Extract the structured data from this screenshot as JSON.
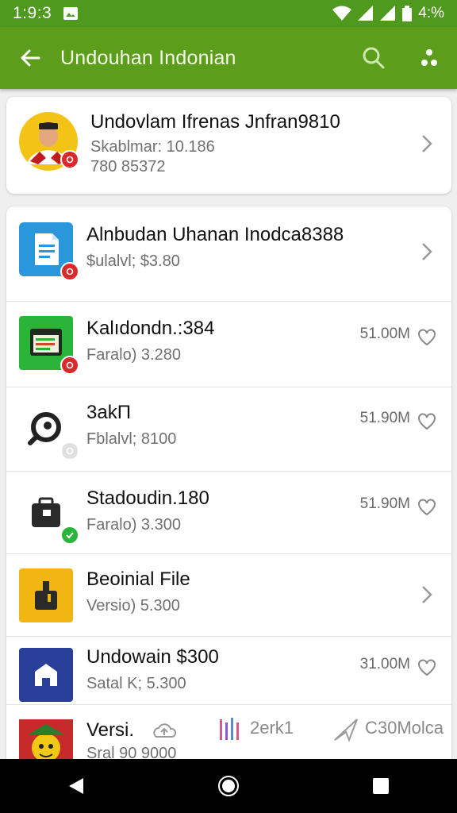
{
  "status_bar": {
    "time": "1:9:3",
    "battery": "4:%"
  },
  "app_bar": {
    "title": "Undouhan Indonian"
  },
  "profile": {
    "title": "Undovlam Ifrenas Jnfran9810",
    "subtitle": "Skablmar: 10.186",
    "detail": "780 85372"
  },
  "items": [
    {
      "title": "Alnbudan Uhanan Inodca8388",
      "sub": "$ulalvl; $3.80",
      "size": "",
      "trail": "chevron",
      "color": "#2a97dc"
    },
    {
      "title": "Kalıdondn.:384",
      "sub": "Faralo) 3.280",
      "size": "51.00M",
      "trail": "heart",
      "color": "#2bb43a"
    },
    {
      "title": "3akΠ",
      "sub": "Fblalvl; 8100",
      "size": "51.90M",
      "trail": "heart",
      "color": "#ffffff"
    },
    {
      "title": "Stadoudin.180",
      "sub": "Faralo) 3.300",
      "size": "51.90M",
      "trail": "heart",
      "color": "#ffffff"
    },
    {
      "title": "Beoinial File",
      "sub": "Versio) 5.300",
      "size": "",
      "trail": "chevron",
      "color": "#f2b613"
    },
    {
      "title": "Undowain $300",
      "sub": "Satal K; 5.300",
      "size": "31.00M",
      "trail": "heart",
      "color": "#2a3f9a"
    }
  ],
  "last_item": {
    "title": "Versi.",
    "sub": "Sral 90 9000"
  },
  "bottom_tabs": {
    "tab2": "2erk1",
    "tab3": "C30Molca"
  },
  "colors": {
    "accent": "#5c9e1c",
    "status": "#4f9a1e",
    "badge_red": "#d92b2b",
    "badge_green": "#2bb43a"
  }
}
